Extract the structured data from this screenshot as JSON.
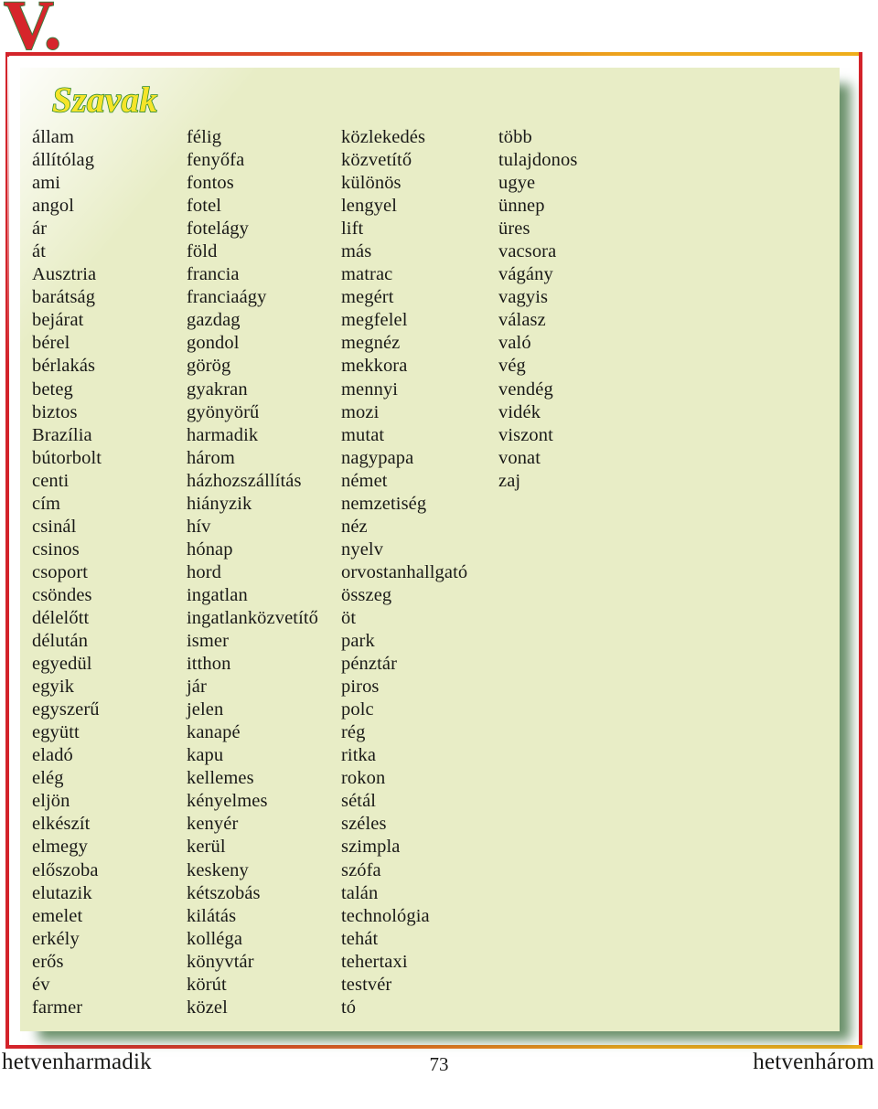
{
  "chapter": {
    "numeral": "V.",
    "numeral_color": "#d6252b",
    "numeral_outline_color": "#3f7a3f"
  },
  "section": {
    "heading": "Szavak",
    "heading_fill_color": "#f5e42a",
    "heading_outline_color": "#2f8a2f"
  },
  "panel": {
    "background_color": "#e8edc6",
    "shadow_color": "#3a6c3a",
    "frame_color_start": "#d3232a",
    "frame_color_end": "#eeae1b"
  },
  "word_list": {
    "columns": [
      {
        "index": 1,
        "words": [
          "állam",
          "állítólag",
          "ami",
          "angol",
          "ár",
          "át",
          "Ausztria",
          "barátság",
          "bejárat",
          "bérel",
          "bérlakás",
          "beteg",
          "biztos",
          "Brazília",
          "bútorbolt",
          "centi",
          "cím",
          "csinál",
          "csinos",
          "csoport",
          "csöndes",
          "délelőtt",
          "délután",
          "egyedül",
          "egyik",
          "egyszerű",
          "együtt",
          "eladó",
          "elég",
          "eljön",
          "elkészít",
          "elmegy",
          "előszoba",
          "elutazik",
          "emelet",
          "erkély",
          "erős",
          "év",
          "farmer"
        ]
      },
      {
        "index": 2,
        "words": [
          "félig",
          "fenyőfa",
          "fontos",
          "fotel",
          "fotelágy",
          "föld",
          "francia",
          "franciaágy",
          "gazdag",
          "gondol",
          "görög",
          "gyakran",
          "gyönyörű",
          "harmadik",
          "három",
          "házhozszállítás",
          "hiányzik",
          "hív",
          "hónap",
          "hord",
          "ingatlan",
          "ingatlanközvetítő",
          "ismer",
          "itthon",
          "jár",
          "jelen",
          "kanapé",
          "kapu",
          "kellemes",
          "kényelmes",
          "kenyér",
          "kerül",
          "keskeny",
          "kétszobás",
          "kilátás",
          "kolléga",
          "könyvtár",
          "körút",
          "közel"
        ]
      },
      {
        "index": 3,
        "words": [
          "közlekedés",
          "közvetítő",
          "különös",
          "lengyel",
          "lift",
          "más",
          "matrac",
          "megért",
          "megfelel",
          "megnéz",
          "mekkora",
          "mennyi",
          "mozi",
          "mutat",
          "nagypapa",
          "német",
          "nemzetiség",
          "néz",
          "nyelv",
          "orvostanhallgató",
          "összeg",
          "öt",
          "park",
          "pénztár",
          "piros",
          "polc",
          "rég",
          "ritka",
          "rokon",
          "sétál",
          "széles",
          "szimpla",
          "szófa",
          "talán",
          "technológia",
          "tehát",
          "tehertaxi",
          "testvér",
          "tó"
        ]
      },
      {
        "index": 4,
        "words": [
          "több",
          "tulajdonos",
          "ugye",
          "ünnep",
          "üres",
          "vacsora",
          "vágány",
          "vagyis",
          "válasz",
          "való",
          "vég",
          "vendég",
          "vidék",
          "viszont",
          "vonat",
          "zaj"
        ]
      }
    ]
  },
  "footer": {
    "left": "hetvenharmadik",
    "page_number": "73",
    "right": "hetvenhárom"
  }
}
